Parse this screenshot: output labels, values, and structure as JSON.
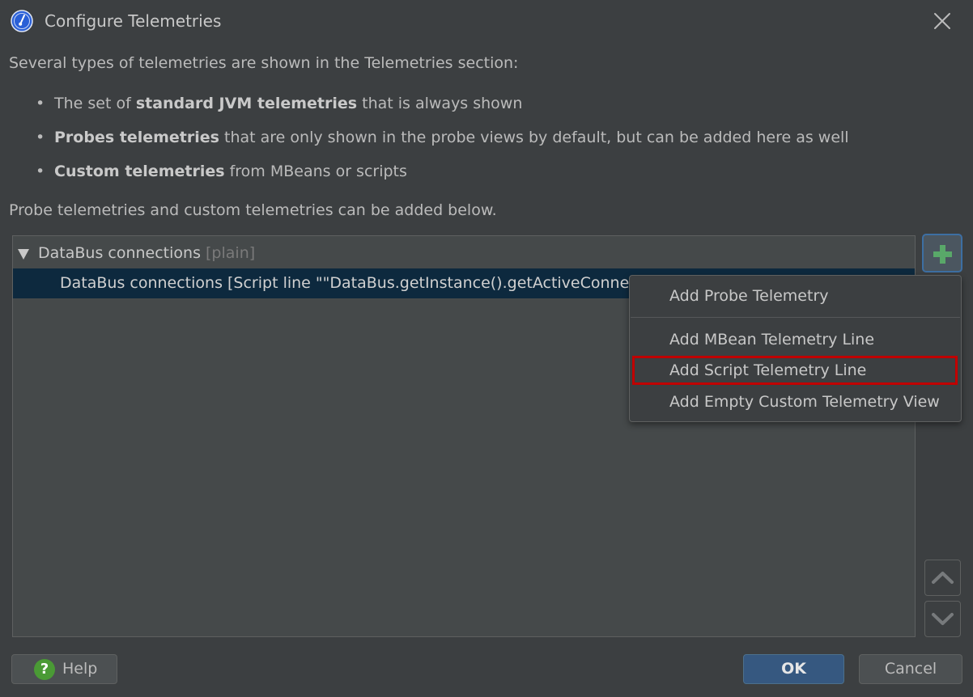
{
  "window": {
    "title": "Configure Telemetries",
    "app_icon": "gauge-icon",
    "close_icon": "close-icon"
  },
  "intro": "Several types of telemetries are shown in the Telemetries section:",
  "bullets": [
    {
      "before": "The set of ",
      "bold": "standard JVM telemetries",
      "after": " that is always shown"
    },
    {
      "before": "",
      "bold": "Probes telemetries",
      "after": " that are only shown in the probe views by default, but can be added here as well"
    },
    {
      "before": "",
      "bold": "Custom telemetries",
      "after": " from MBeans or scripts"
    }
  ],
  "below_text": "Probe telemetries and custom telemetries can be added below.",
  "list": {
    "group": {
      "label": "DataBus connections",
      "tag": "[plain]"
    },
    "selected_item": "DataBus connections [Script line \"\"DataBus.getInstance().getActiveConnectio"
  },
  "toolbar": {
    "add_icon": "plus-icon",
    "up_icon": "chevron-up-icon",
    "down_icon": "chevron-down-icon"
  },
  "menu": {
    "items": [
      "Add Probe Telemetry",
      "Add MBean Telemetry Line",
      "Add Script Telemetry Line",
      "Add Empty Custom Telemetry View"
    ],
    "highlighted": "Add Script Telemetry Line"
  },
  "buttons": {
    "help": "Help",
    "ok": "OK",
    "cancel": "Cancel"
  },
  "colors": {
    "background": "#3c3f41",
    "selection": "#0d293e",
    "accent": "#365880",
    "add_green": "#59a869",
    "highlight_border": "#c00000"
  }
}
